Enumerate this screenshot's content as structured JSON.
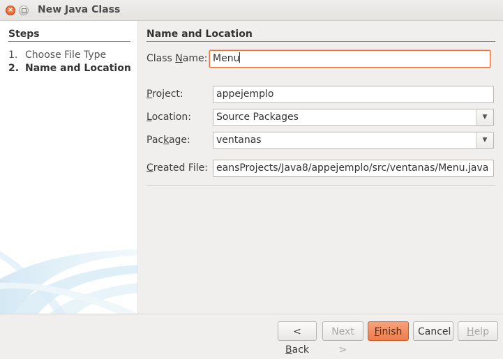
{
  "window": {
    "title": "New Java Class",
    "close_icon": "close-icon",
    "maximize_icon": "maximize-icon"
  },
  "steps": {
    "title": "Steps",
    "items": [
      {
        "num": "1.",
        "label": "Choose File Type"
      },
      {
        "num": "2.",
        "label": "Name and Location"
      }
    ]
  },
  "main": {
    "title": "Name and Location",
    "class_name": {
      "label_pre": "Class ",
      "label_key": "N",
      "label_post": "ame:",
      "value": "Menu"
    },
    "project": {
      "label_pre": "",
      "label_key": "P",
      "label_post": "roject:",
      "value": "appejemplo"
    },
    "location": {
      "label_pre": "",
      "label_key": "L",
      "label_post": "ocation:",
      "value": "Source Packages"
    },
    "package": {
      "label_pre": "Pac",
      "label_key": "k",
      "label_post": "age:",
      "value": "ventanas"
    },
    "created_file": {
      "label_pre": "",
      "label_key": "C",
      "label_post": "reated File:",
      "value": "eansProjects/Java8/appejemplo/src/ventanas/Menu.java"
    }
  },
  "buttons": {
    "back": {
      "pre": "< ",
      "key": "B",
      "post": "ack"
    },
    "next": "Next >",
    "finish": {
      "pre": "",
      "key": "F",
      "post": "inish"
    },
    "cancel": "Cancel",
    "help": {
      "pre": "",
      "key": "H",
      "post": "elp"
    }
  },
  "colors": {
    "accent": "#e8703a",
    "finish_button": "#ee7c4b"
  }
}
